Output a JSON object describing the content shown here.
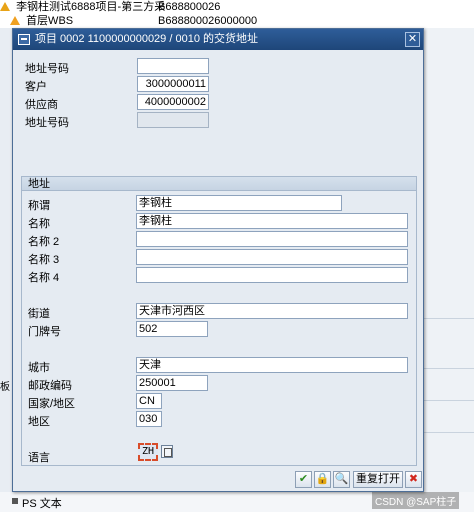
{
  "background": {
    "tree_row1": {
      "label": "李钢柱测试6888项目-第三方采",
      "code": "B688800026"
    },
    "tree_row2": {
      "label": "首层WBS",
      "code": "B688800026000000"
    },
    "side_label1": "板",
    "ps_item": "PS 文本"
  },
  "watermark": "CSDN @SAP柱子",
  "dialog": {
    "title": "项目 0002 1100000000029 / 0010 的交货地址",
    "close_symbol": "✕"
  },
  "header_fields": {
    "address_no_label": "地址号码",
    "address_no_value": "",
    "customer_label": "客户",
    "customer_value": "3000000011",
    "vendor_label": "供应商",
    "vendor_value": "4000000002",
    "address_no2_label": "地址号码",
    "address_no2_value": ""
  },
  "address_group": {
    "header": "地址",
    "title_label": "称谓",
    "title_value": "李钢柱",
    "name_label": "名称",
    "name_value": "李钢柱",
    "name2_label": "名称 2",
    "name2_value": "",
    "name3_label": "名称 3",
    "name3_value": "",
    "name4_label": "名称 4",
    "name4_value": "",
    "street_label": "街道",
    "street_value": "天津市河西区",
    "house_no_label": "门牌号",
    "house_no_value": "502",
    "city_label": "城市",
    "city_value": "天津",
    "postal_label": "邮政编码",
    "postal_value": "250001",
    "country_label": "国家/地区",
    "country_value": "CN",
    "region_label": "地区",
    "region_value": "030",
    "language_label": "语言",
    "language_value": "ZH"
  },
  "footer": {
    "confirm_symbol": "✔",
    "lock_symbol": "🔒",
    "find_symbol": "🔍",
    "reset_label": "重复打开",
    "cancel_symbol": "✖"
  }
}
